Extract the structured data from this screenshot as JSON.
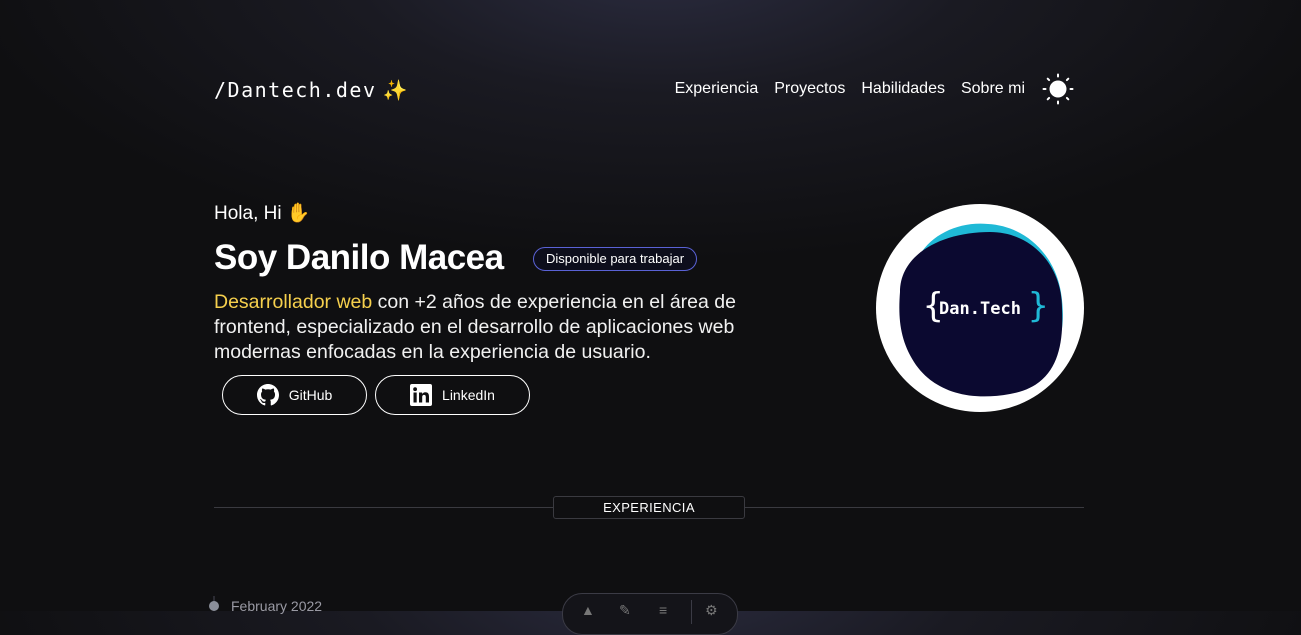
{
  "header": {
    "logo_text": "/Dantech.dev",
    "logo_sparkle": "✨",
    "nav": [
      {
        "label": "Experiencia"
      },
      {
        "label": "Proyectos"
      },
      {
        "label": "Habilidades"
      },
      {
        "label": "Sobre mi"
      }
    ],
    "theme_icon": "sun-icon"
  },
  "hero": {
    "greeting": "Hola, Hi",
    "greeting_emoji": "✋",
    "name": "Soy Danilo Macea",
    "badge": "Disponible para trabajar",
    "desc_highlight": "Desarrollador web",
    "desc_rest": " con +2 años de experiencia en el área de frontend, especializado en el desarrollo de aplicaciones web modernas enfocadas en la experiencia de usuario.",
    "buttons": {
      "github": {
        "label": "GitHub",
        "icon": "github-icon"
      },
      "linkedin": {
        "label": "LinkedIn",
        "icon": "linkedin-icon"
      }
    },
    "avatar_logo_text": "Dan.Tech"
  },
  "sections": {
    "experience_label": "EXPERIENCIA"
  },
  "timeline": {
    "first_date": "February 2022"
  },
  "colors": {
    "accent_yellow": "#f6d04d",
    "badge_border": "#5a62d6",
    "logo_bg": "#0b0930",
    "logo_cyan": "#1fb9d6"
  }
}
